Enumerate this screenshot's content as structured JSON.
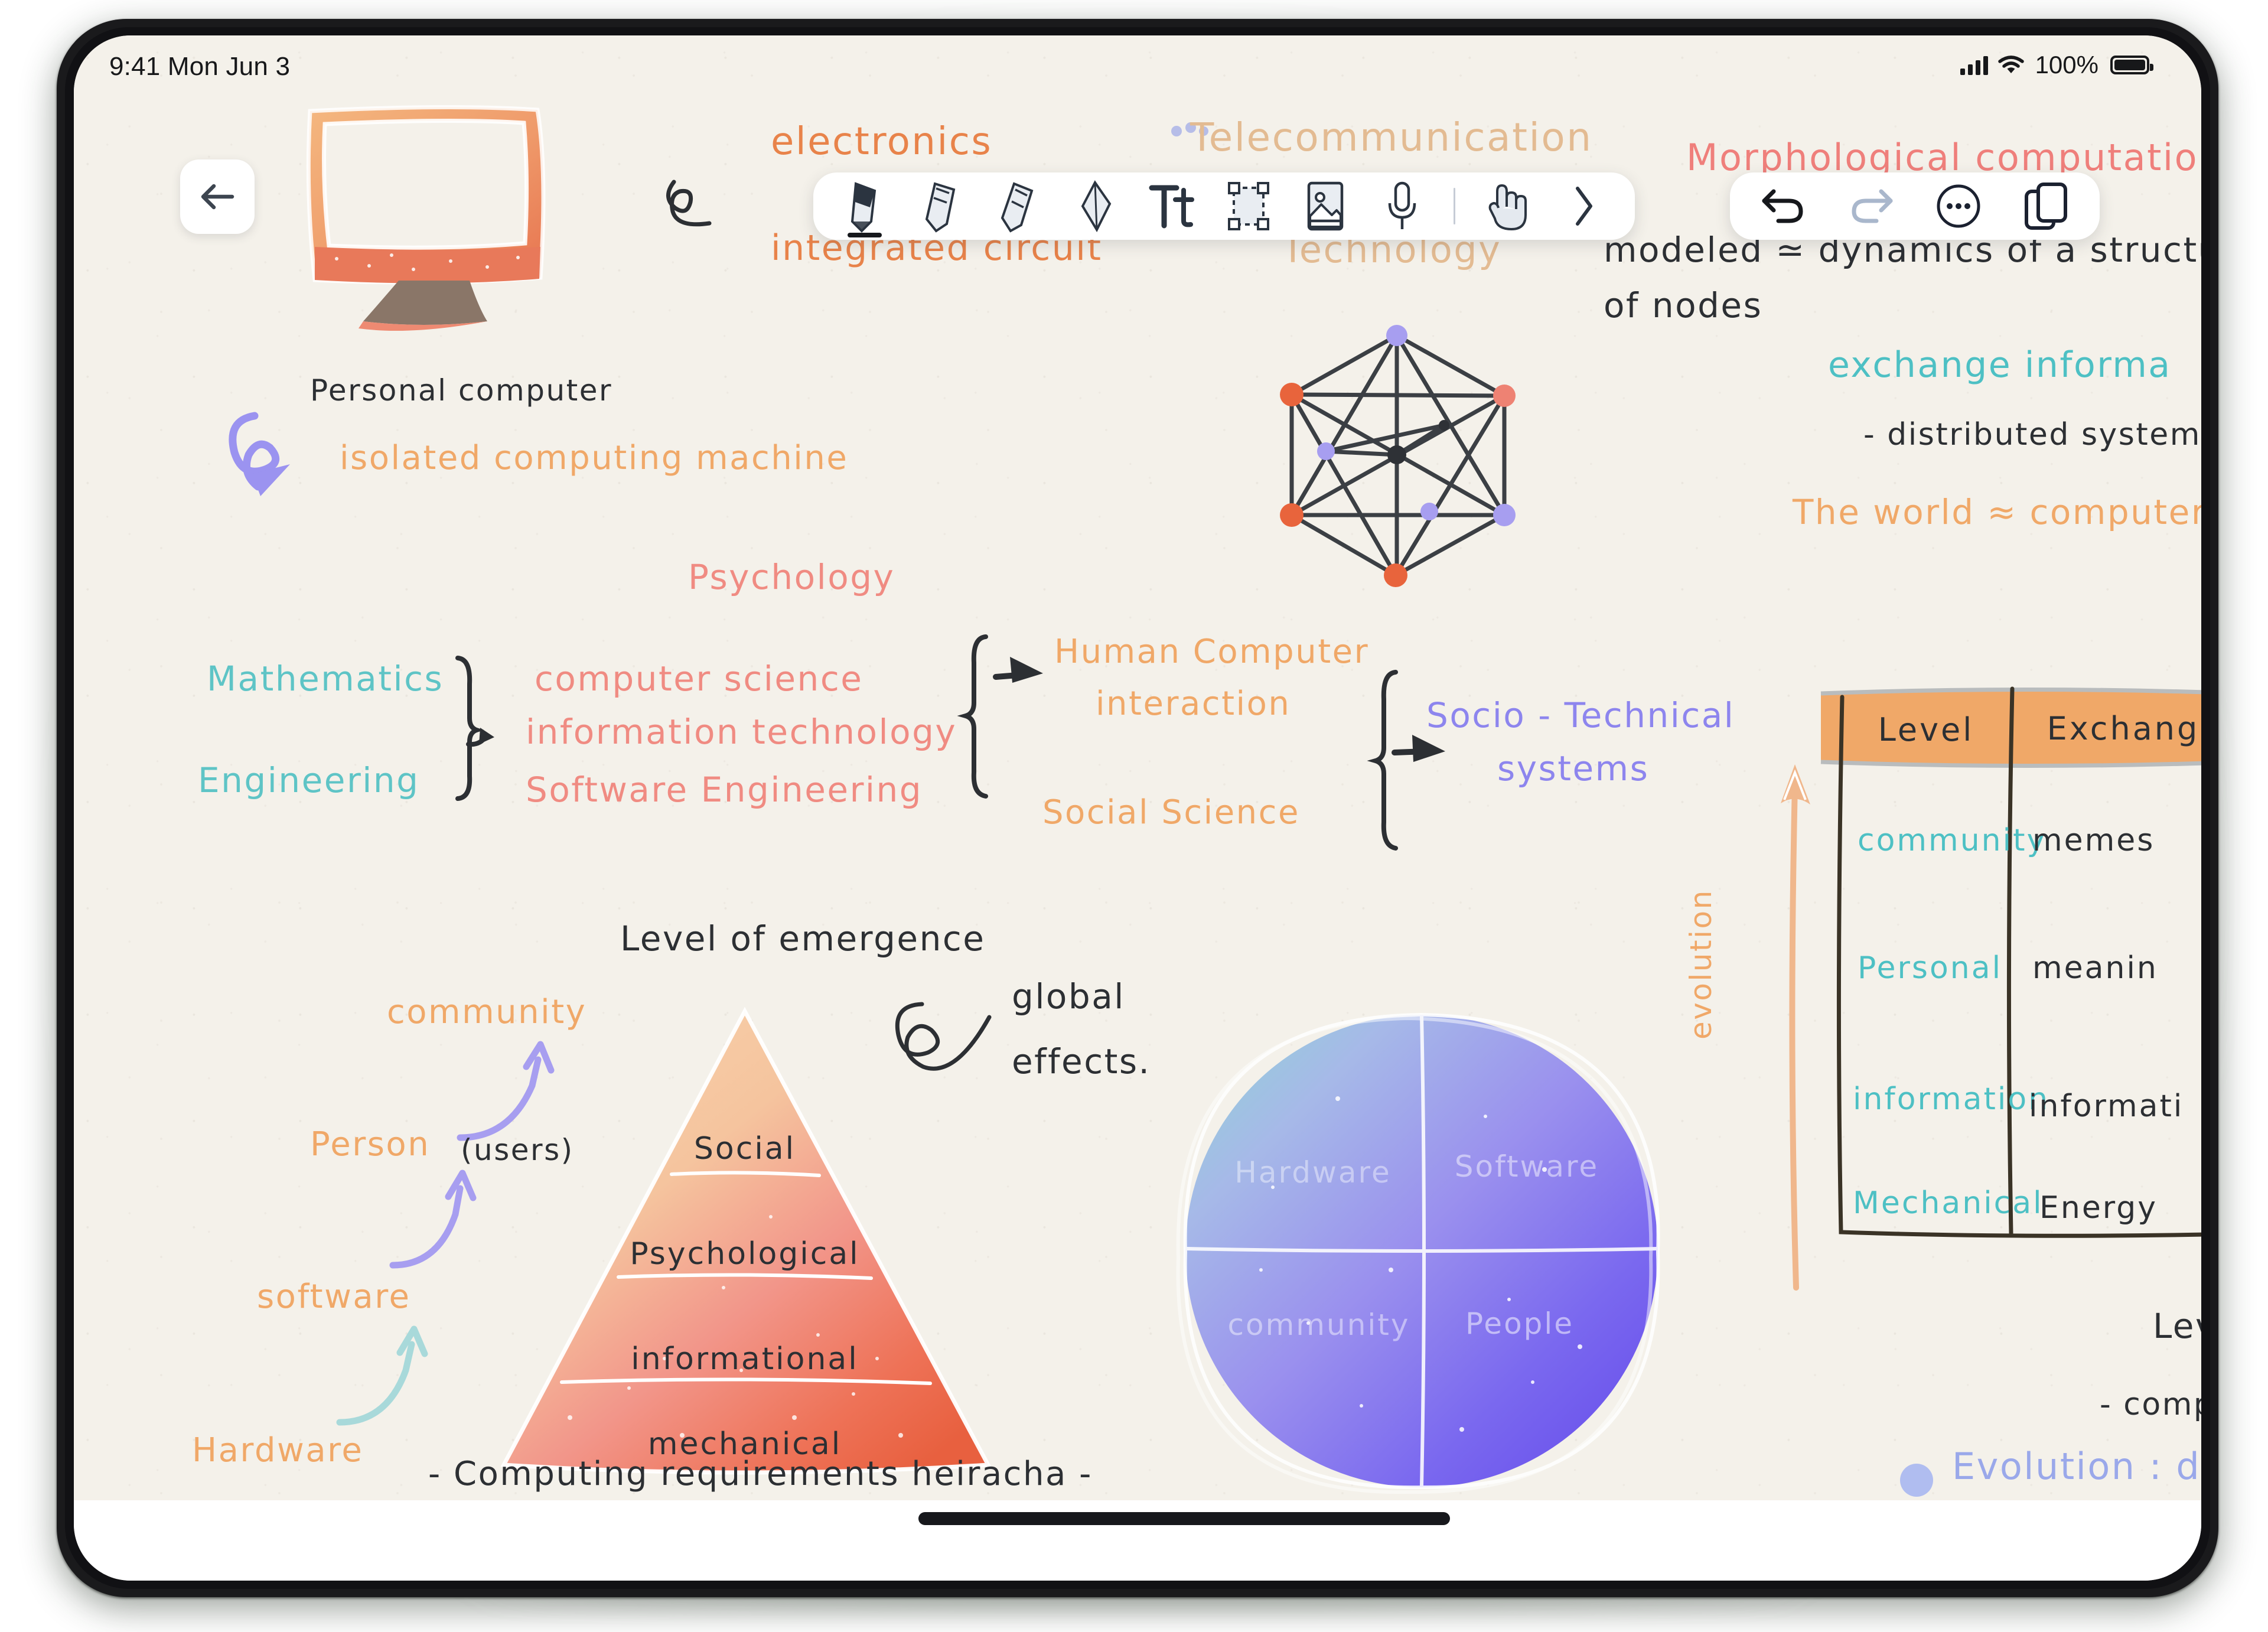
{
  "status_bar": {
    "time": "9:41 Mon Jun 3",
    "battery_percent": "100%",
    "signal_icon": "cellular-signal-icon",
    "wifi_icon": "wifi-icon",
    "battery_icon": "battery-full-icon"
  },
  "navigation": {
    "back_icon": "arrow-left-icon"
  },
  "toolbar": {
    "tools": [
      {
        "name": "pen-tool",
        "icon": "pen-icon",
        "selected": true
      },
      {
        "name": "pencil-tool",
        "icon": "pencil-icon",
        "selected": false
      },
      {
        "name": "highlighter-tool",
        "icon": "highlighter-icon",
        "selected": false
      },
      {
        "name": "eraser-tool",
        "icon": "eraser-icon",
        "selected": false
      },
      {
        "name": "text-tool",
        "icon": "text-tt-icon",
        "selected": false,
        "label": "Tt"
      },
      {
        "name": "selection-tool",
        "icon": "marquee-select-icon",
        "selected": false
      },
      {
        "name": "image-tool",
        "icon": "image-icon",
        "selected": false
      },
      {
        "name": "audio-tool",
        "icon": "microphone-icon",
        "selected": false
      },
      {
        "name": "hand-tool",
        "icon": "hand-touch-icon",
        "selected": false
      },
      {
        "name": "expand-toolbar",
        "icon": "chevron-right-icon",
        "selected": false
      }
    ]
  },
  "toolbar_right": {
    "actions": [
      {
        "name": "undo-button",
        "icon": "undo-arrow-icon",
        "enabled": true
      },
      {
        "name": "redo-button",
        "icon": "redo-arrow-icon",
        "enabled": false
      },
      {
        "name": "more-options-button",
        "icon": "ellipsis-circle-icon",
        "enabled": true
      },
      {
        "name": "pages-button",
        "icon": "pages-copy-icon",
        "enabled": true
      }
    ]
  },
  "notes": {
    "monitor_caption": "Personal computer",
    "isolated_machine": "isolated computing machine",
    "electronics": "electronics",
    "integrated_circuit": "integrated  circuit",
    "telecommunication": "Telecommunication",
    "technology": "Technology",
    "morphological": "Morphological  computation",
    "modeled_line1": "modeled ≃ dynamics of a structu",
    "modeled_line2": "of nodes",
    "exchange_information": "exchange  informa",
    "distributed_systems": "- distributed  systems",
    "world_computer": "The world ≈ computer",
    "psychology": "Psychology",
    "mathematics": "Mathematics",
    "engineering": "Engineering",
    "computer_science": "computer  science",
    "information_technology": "information  technology",
    "software_engineering": "Software  Engineering",
    "hci_line1": "Human  Computer",
    "hci_line2": "interaction",
    "social_science": "Social  Science",
    "socio_technical_line1": "Socio - Technical",
    "socio_technical_line2": "systems",
    "level_of_emergence": "Level  of  emergence",
    "global_effects_line1": "global",
    "global_effects_line2": "effects.",
    "left_labels": [
      {
        "text": "community",
        "color": "#f0a868"
      },
      {
        "text": "Person",
        "suffix": "(users)",
        "color": "#f0a868"
      },
      {
        "text": "software",
        "color": "#f0a868"
      },
      {
        "text": "Hardware",
        "color": "#f0a868"
      }
    ],
    "bottom_line": "- Computing  requirements  heiracha -",
    "evolution_axis": "evolution",
    "level_below_table": "Level",
    "computing_is": "- computing i",
    "evolution_driven": "Evolution : driven b"
  },
  "pyramid": {
    "layers": [
      "Social",
      "Psychological",
      "informational",
      "mechanical"
    ],
    "colors": [
      "#f7d2ab",
      "#f6c9a2",
      "#f0907f",
      "#ea6a52"
    ]
  },
  "circle_quadrants": {
    "top_left": "Hardware",
    "top_right": "Software",
    "bottom_left": "community",
    "bottom_right": "People"
  },
  "table": {
    "headers": [
      "Level",
      "Exchang"
    ],
    "rows": [
      {
        "level": "community",
        "exchange": "memes"
      },
      {
        "level": "Personal",
        "exchange": "meanin"
      },
      {
        "level": "information",
        "exchange": "informati"
      },
      {
        "level": "Mechanical",
        "exchange": "Energy"
      }
    ],
    "header_bg": "#f0a868"
  },
  "network_graph": {
    "node_colors": {
      "orange": "#e8643c",
      "salmon": "#ee8273",
      "purple": "#a79ef0",
      "dark": "#2e3136"
    },
    "outer_nodes": 6,
    "inner_nodes": 3
  },
  "colors": {
    "paper": "#f4f1ea",
    "accent_orange": "#e8834a",
    "accent_teal": "#5ec4c6",
    "accent_purple": "#8d85ee",
    "accent_pink": "#ef7f7b",
    "ink": "#2c2f33"
  }
}
